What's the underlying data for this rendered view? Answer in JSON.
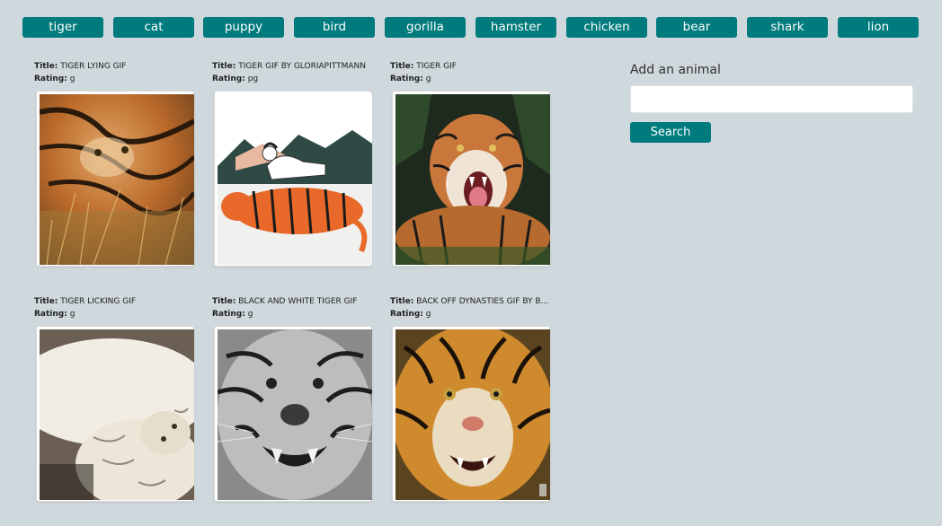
{
  "animal_buttons": [
    "tiger",
    "cat",
    "puppy",
    "bird",
    "gorilla",
    "hamster",
    "chicken",
    "bear",
    "shark",
    "lion"
  ],
  "gifs": [
    {
      "title_label": "Title:",
      "title": "TIGER LYING GIF",
      "rating_label": "Rating:",
      "rating": "g",
      "scene": "tiger-lying-in-grass"
    },
    {
      "title_label": "Title:",
      "title": "TIGER GIF BY GLORIAPITTMANN",
      "rating_label": "Rating:",
      "rating": "pg",
      "scene": "illustrated-woman-on-tiger"
    },
    {
      "title_label": "Title:",
      "title": "TIGER GIF",
      "rating_label": "Rating:",
      "rating": "g",
      "scene": "tiger-roaring-in-jungle"
    },
    {
      "title_label": "Title:",
      "title": "TIGER LICKING GIF",
      "rating_label": "Rating:",
      "rating": "g",
      "scene": "white-tiger-lying-on-back"
    },
    {
      "title_label": "Title:",
      "title": "BLACK AND WHITE TIGER GIF",
      "rating_label": "Rating:",
      "rating": "g",
      "scene": "black-and-white-tiger-snarl"
    },
    {
      "title_label": "Title:",
      "title": "BACK OFF DYNASTIES GIF BY B...",
      "rating_label": "Rating:",
      "rating": "g",
      "scene": "tiger-snarl-closeup"
    }
  ],
  "sidebar": {
    "label": "Add an animal",
    "input_value": "",
    "input_placeholder": "",
    "search_label": "Search"
  },
  "colors": {
    "background": "#cfd8dc",
    "button": "#007b7d",
    "button_text": "#ffffff"
  }
}
